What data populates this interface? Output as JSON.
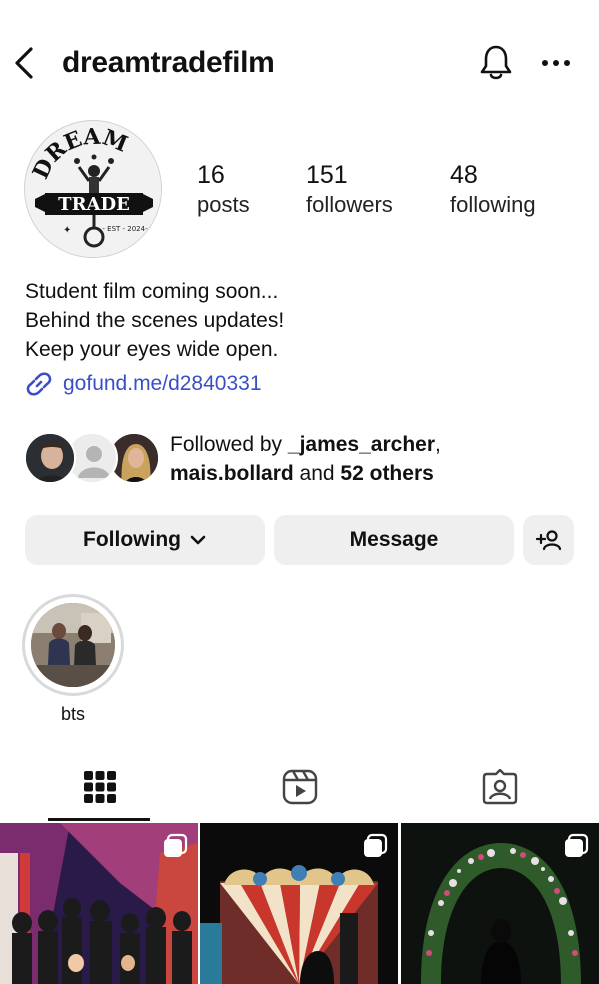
{
  "header": {
    "username": "dreamtradefilm",
    "back_icon": "chevron-left-icon",
    "bell_icon": "bell-icon",
    "more_icon": "ellipsis-icon"
  },
  "profile": {
    "avatar_logo": {
      "top_text": "DREAM",
      "banner_text": "TRADE",
      "est_text": "- EST - 2024-"
    },
    "stats": [
      {
        "value": "16",
        "label": "posts"
      },
      {
        "value": "151",
        "label": "followers"
      },
      {
        "value": "48",
        "label": "following"
      }
    ],
    "bio_lines": [
      "Student film coming soon...",
      "Behind the scenes updates!",
      "Keep your eyes wide open."
    ],
    "link": "gofund.me/d2840331"
  },
  "followed_by": {
    "prefix": "Followed by ",
    "user1": "_james_archer",
    "comma": ",",
    "user2": "mais.bollard",
    "and_text": " and ",
    "others": "52 others"
  },
  "actions": {
    "following_label": "Following",
    "message_label": "Message"
  },
  "highlights": [
    {
      "label": "bts"
    }
  ],
  "tabs": [
    "grid-icon",
    "reels-icon",
    "tagged-icon"
  ],
  "colors": {
    "link": "#3a4fc7",
    "button_bg": "#efefef"
  }
}
